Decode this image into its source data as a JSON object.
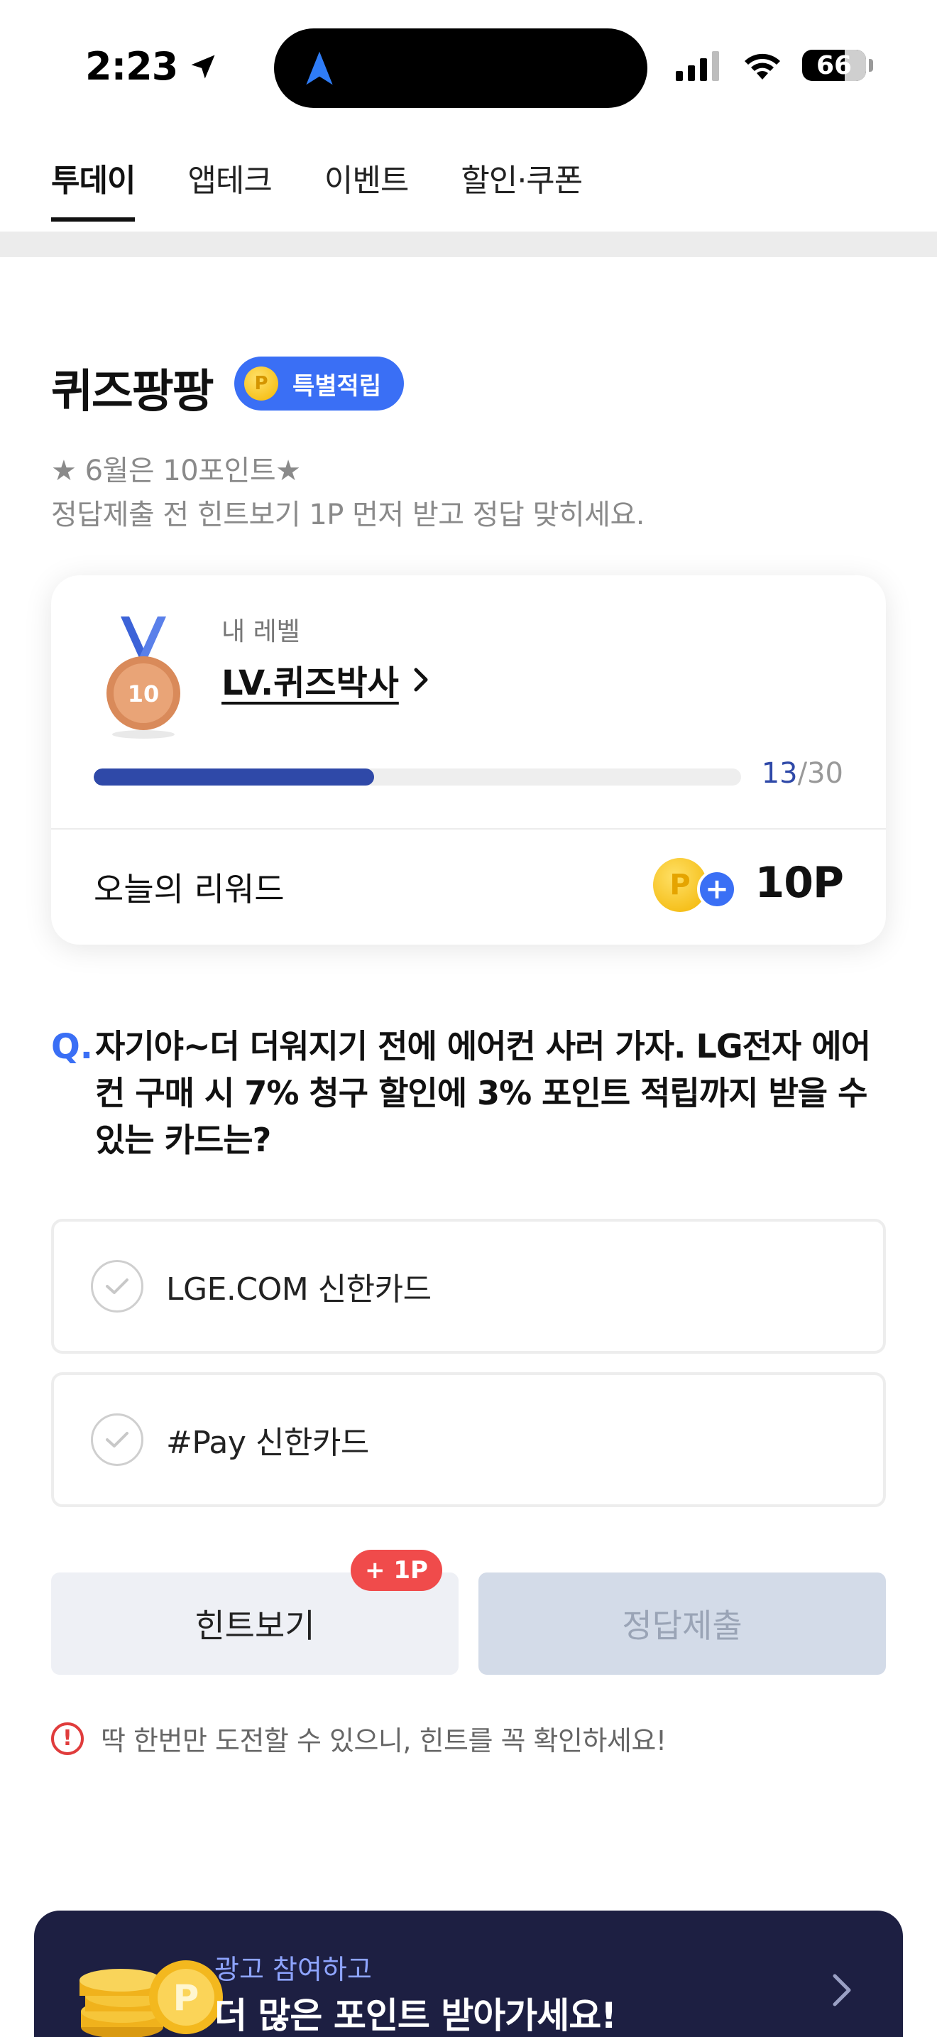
{
  "status_bar": {
    "time": "2:23",
    "battery": "66"
  },
  "tabs": [
    {
      "label": "투데이"
    },
    {
      "label": "앱테크"
    },
    {
      "label": "이벤트"
    },
    {
      "label": "할인·쿠폰"
    }
  ],
  "quiz": {
    "title": "퀴즈팡팡",
    "badge_label": "특별적립",
    "badge_coin": "P",
    "subtitle_1": "★ 6월은 10포인트★",
    "subtitle_2": "정답제출 전 힌트보기 1P 먼저 받고 정답 맞히세요."
  },
  "level_card": {
    "caption": "내 레벨",
    "level_name": "LV.퀴즈박사",
    "medal_number": "10",
    "progress_current": "13",
    "progress_total": "/30",
    "progress_fraction": 0.433,
    "reward_label": "오늘의 리워드",
    "reward_coin": "P",
    "reward_value": "10P"
  },
  "question": {
    "mark": "Q.",
    "text": "자기야~더 더워지기 전에 에어컨 사러 가자. LG전자 에어컨 구매 시 7% 청구 할인에 3% 포인트 적립까지 받을 수 있는 카드는?"
  },
  "options": [
    {
      "label": "LGE.COM 신한카드"
    },
    {
      "label": "#Pay 신한카드"
    }
  ],
  "actions": {
    "hint_label": "힌트보기",
    "hint_badge": "+ 1P",
    "submit_label": "정답제출"
  },
  "notice": {
    "icon": "!",
    "text": "딱 한번만 도전할 수 있으니, 힌트를 꼭 확인하세요!"
  },
  "ad_banner": {
    "subtitle": "광고 참여하고",
    "title": "더 많은 포인트 받아가세요!"
  },
  "colors": {
    "accent_blue": "#3a6ff5",
    "progress_blue": "#2f49a8",
    "badge_red": "#f04b4b",
    "banner_navy": "#1d1f42"
  },
  "icons": [
    "location-arrow-icon",
    "signal-icon",
    "wifi-icon",
    "battery-icon",
    "coin-icon",
    "medal-icon",
    "chevron-right-icon",
    "check-icon",
    "plus-icon",
    "alert-icon",
    "coin-stack-icon"
  ]
}
